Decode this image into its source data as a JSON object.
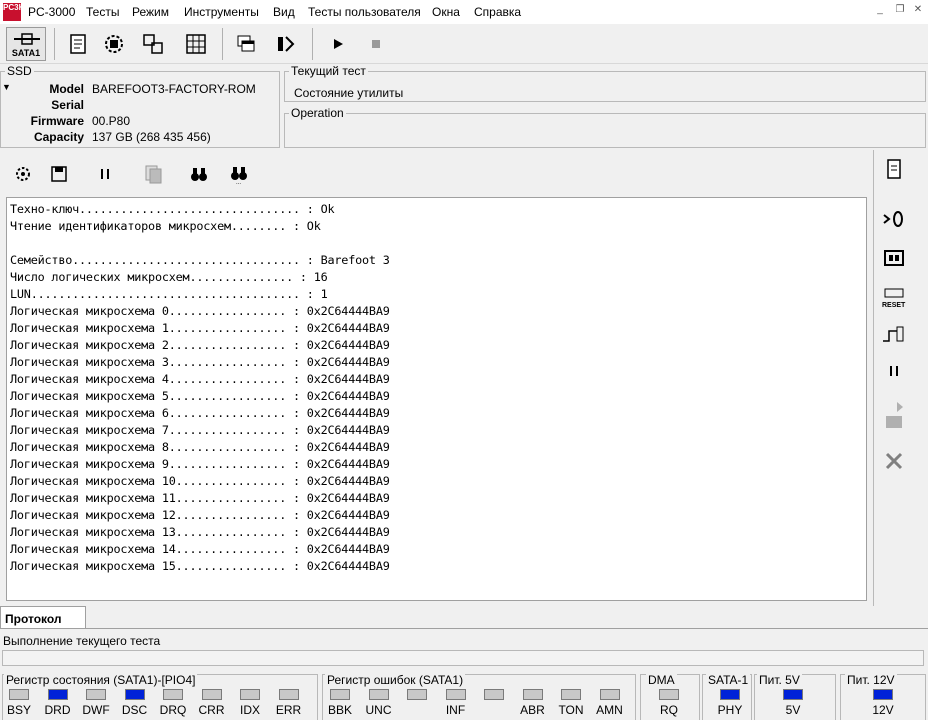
{
  "app": {
    "title": "PC-3000",
    "icon_text": "PC3K"
  },
  "menu": [
    "Тесты",
    "Режим",
    "Инструменты",
    "Вид",
    "Тесты пользователя",
    "Окна",
    "Справка"
  ],
  "toolbar": {
    "sata_label": "SATA1"
  },
  "ssd": {
    "legend": "SSD",
    "model_label": "Model",
    "model_value": "BAREFOOT3-FACTORY-ROM",
    "serial_label": "Serial",
    "serial_value": "",
    "firmware_label": "Firmware",
    "firmware_value": "00.P80",
    "capacity_label": "Capacity",
    "capacity_value": "137 GB (268 435 456)"
  },
  "current_test": {
    "legend": "Текущий тест",
    "value": "Состояние утилиты"
  },
  "operation": {
    "legend": "Operation",
    "value": ""
  },
  "log_lines": [
    "Техно-ключ................................ : Ok",
    "Чтение идентификаторов микросхем........ : Ok",
    "",
    "Семейство................................. : Barefoot 3",
    "Число логических микросхем............... : 16",
    "LUN....................................... : 1",
    "Логическая микросхема 0................. : 0x2C64444BA9",
    "Логическая микросхема 1................. : 0x2C64444BA9",
    "Логическая микросхема 2................. : 0x2C64444BA9",
    "Логическая микросхема 3................. : 0x2C64444BA9",
    "Логическая микросхема 4................. : 0x2C64444BA9",
    "Логическая микросхема 5................. : 0x2C64444BA9",
    "Логическая микросхема 6................. : 0x2C64444BA9",
    "Логическая микросхема 7................. : 0x2C64444BA9",
    "Логическая микросхема 8................. : 0x2C64444BA9",
    "Логическая микросхема 9................. : 0x2C64444BA9",
    "Логическая микросхема 10................ : 0x2C64444BA9",
    "Логическая микросхема 11................ : 0x2C64444BA9",
    "Логическая микросхема 12................ : 0x2C64444BA9",
    "Логическая микросхема 13................ : 0x2C64444BA9",
    "Логическая микросхема 14................ : 0x2C64444BA9",
    "Логическая микросхема 15................ : 0x2C64444BA9"
  ],
  "tabs": {
    "protocol": "Протокол"
  },
  "progress": {
    "label": "Выполнение текущего теста",
    "fraction": 0
  },
  "status_register": {
    "title": "Регистр состояния (SATA1)-[PIO4]",
    "leds": [
      {
        "name": "BSY",
        "on": false
      },
      {
        "name": "DRD",
        "on": true
      },
      {
        "name": "DWF",
        "on": false
      },
      {
        "name": "DSC",
        "on": true
      },
      {
        "name": "DRQ",
        "on": false
      },
      {
        "name": "CRR",
        "on": false
      },
      {
        "name": "IDX",
        "on": false
      },
      {
        "name": "ERR",
        "on": false
      }
    ]
  },
  "error_register": {
    "title": "Регистр ошибок  (SATA1)",
    "leds": [
      {
        "name": "BBK",
        "on": false
      },
      {
        "name": "UNC",
        "on": false
      },
      {
        "name": "",
        "on": false
      },
      {
        "name": "INF",
        "on": false
      },
      {
        "name": "",
        "on": false
      },
      {
        "name": "ABR",
        "on": false
      },
      {
        "name": "TON",
        "on": false
      },
      {
        "name": "AMN",
        "on": false
      }
    ]
  },
  "dma": {
    "title": "DMA",
    "led": {
      "name": "RQ",
      "on": false
    }
  },
  "sata": {
    "title": "SATA-1",
    "led": {
      "name": "PHY",
      "on": true
    }
  },
  "power5": {
    "title": "Пит. 5V",
    "led": {
      "name": "5V",
      "on": true
    }
  },
  "power12": {
    "title": "Пит. 12V",
    "led": {
      "name": "12V",
      "on": true
    }
  },
  "colors": {
    "led_on": "#0022d8",
    "led_off": "#c8c8c8",
    "brand": "#c8102e"
  }
}
